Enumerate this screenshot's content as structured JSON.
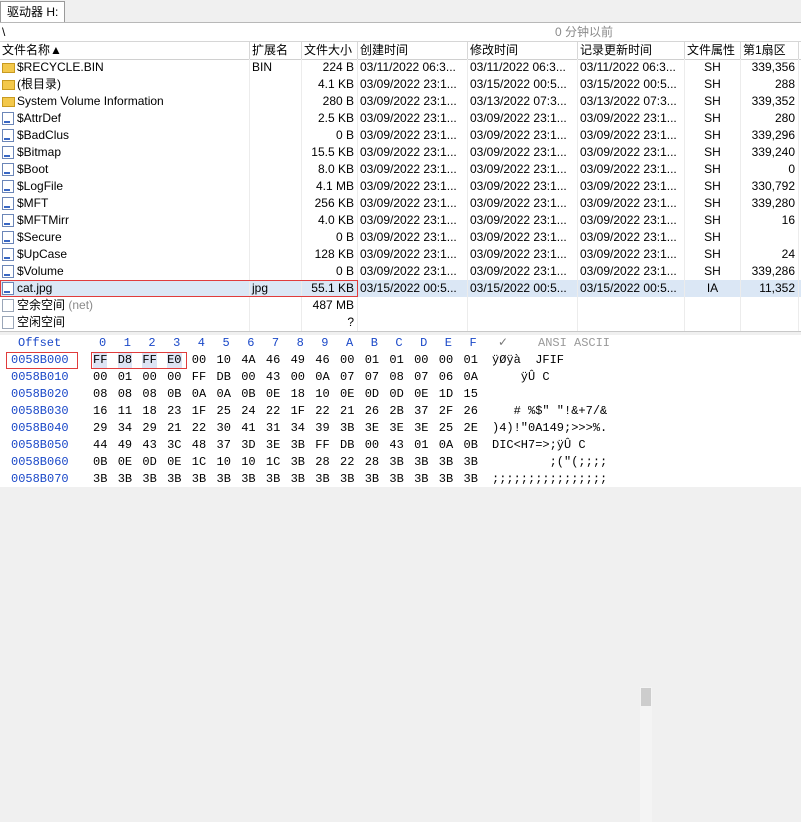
{
  "tab": {
    "label": "驱动器 H:"
  },
  "path": {
    "text": "\\",
    "time_ago": "0 分钟以前"
  },
  "columns": [
    "文件名称▲",
    "扩展名",
    "文件大小",
    "创建时间",
    "修改时间",
    "记录更新时间",
    "文件属性",
    "第1扇区"
  ],
  "rows": [
    {
      "name": "$RECYCLE.BIN",
      "ext": "BIN",
      "size": "224 B",
      "created": "03/11/2022",
      "ctime": "06:3...",
      "modified": "03/11/2022",
      "mtime": "06:3...",
      "updated": "03/11/2022",
      "utime": "06:3...",
      "attr": "SH",
      "sector": "339,356",
      "icon": "folder"
    },
    {
      "name": "(根目录)",
      "ext": "",
      "size": "4.1 KB",
      "created": "03/09/2022",
      "ctime": "23:1...",
      "modified": "03/15/2022",
      "mtime": "00:5...",
      "updated": "03/15/2022",
      "utime": "00:5...",
      "attr": "SH",
      "sector": "288",
      "icon": "folder"
    },
    {
      "name": "System Volume Information",
      "ext": "",
      "size": "280 B",
      "created": "03/09/2022",
      "ctime": "23:1...",
      "modified": "03/13/2022",
      "mtime": "07:3...",
      "updated": "03/13/2022",
      "utime": "07:3...",
      "attr": "SH",
      "sector": "339,352",
      "icon": "folder"
    },
    {
      "name": "$AttrDef",
      "ext": "",
      "size": "2.5 KB",
      "created": "03/09/2022",
      "ctime": "23:1...",
      "modified": "03/09/2022",
      "mtime": "23:1...",
      "updated": "03/09/2022",
      "utime": "23:1...",
      "attr": "SH",
      "sector": "280",
      "icon": "file"
    },
    {
      "name": "$BadClus",
      "ext": "",
      "size": "0 B",
      "created": "03/09/2022",
      "ctime": "23:1...",
      "modified": "03/09/2022",
      "mtime": "23:1...",
      "updated": "03/09/2022",
      "utime": "23:1...",
      "attr": "SH",
      "sector": "339,296",
      "icon": "file"
    },
    {
      "name": "$Bitmap",
      "ext": "",
      "size": "15.5 KB",
      "created": "03/09/2022",
      "ctime": "23:1...",
      "modified": "03/09/2022",
      "mtime": "23:1...",
      "updated": "03/09/2022",
      "utime": "23:1...",
      "attr": "SH",
      "sector": "339,240",
      "icon": "file"
    },
    {
      "name": "$Boot",
      "ext": "",
      "size": "8.0 KB",
      "created": "03/09/2022",
      "ctime": "23:1...",
      "modified": "03/09/2022",
      "mtime": "23:1...",
      "updated": "03/09/2022",
      "utime": "23:1...",
      "attr": "SH",
      "sector": "0",
      "icon": "file"
    },
    {
      "name": "$LogFile",
      "ext": "",
      "size": "4.1 MB",
      "created": "03/09/2022",
      "ctime": "23:1...",
      "modified": "03/09/2022",
      "mtime": "23:1...",
      "updated": "03/09/2022",
      "utime": "23:1...",
      "attr": "SH",
      "sector": "330,792",
      "icon": "file"
    },
    {
      "name": "$MFT",
      "ext": "",
      "size": "256 KB",
      "created": "03/09/2022",
      "ctime": "23:1...",
      "modified": "03/09/2022",
      "mtime": "23:1...",
      "updated": "03/09/2022",
      "utime": "23:1...",
      "attr": "SH",
      "sector": "339,280",
      "icon": "file"
    },
    {
      "name": "$MFTMirr",
      "ext": "",
      "size": "4.0 KB",
      "created": "03/09/2022",
      "ctime": "23:1...",
      "modified": "03/09/2022",
      "mtime": "23:1...",
      "updated": "03/09/2022",
      "utime": "23:1...",
      "attr": "SH",
      "sector": "16",
      "icon": "file"
    },
    {
      "name": "$Secure",
      "ext": "",
      "size": "0 B",
      "created": "03/09/2022",
      "ctime": "23:1...",
      "modified": "03/09/2022",
      "mtime": "23:1...",
      "updated": "03/09/2022",
      "utime": "23:1...",
      "attr": "SH",
      "sector": "",
      "icon": "file"
    },
    {
      "name": "$UpCase",
      "ext": "",
      "size": "128 KB",
      "created": "03/09/2022",
      "ctime": "23:1...",
      "modified": "03/09/2022",
      "mtime": "23:1...",
      "updated": "03/09/2022",
      "utime": "23:1...",
      "attr": "SH",
      "sector": "24",
      "icon": "file"
    },
    {
      "name": "$Volume",
      "ext": "",
      "size": "0 B",
      "created": "03/09/2022",
      "ctime": "23:1...",
      "modified": "03/09/2022",
      "mtime": "23:1...",
      "updated": "03/09/2022",
      "utime": "23:1...",
      "attr": "SH",
      "sector": "339,286",
      "icon": "file"
    },
    {
      "name": "cat.jpg",
      "ext": "jpg",
      "size": "55.1 KB",
      "created": "03/15/2022",
      "ctime": "00:5...",
      "modified": "03/15/2022",
      "mtime": "00:5...",
      "updated": "03/15/2022",
      "utime": "00:5...",
      "attr": "IA",
      "sector": "11,352",
      "icon": "file",
      "selected": true
    },
    {
      "name": "空余空间",
      "name_note": "(net)",
      "ext": "",
      "size": "487 MB",
      "created": "",
      "ctime": "",
      "modified": "",
      "mtime": "",
      "updated": "",
      "utime": "",
      "attr": "",
      "sector": "",
      "icon": "space"
    },
    {
      "name": "空闲空间",
      "ext": "",
      "size": "?",
      "created": "",
      "ctime": "",
      "modified": "",
      "mtime": "",
      "updated": "",
      "utime": "",
      "attr": "",
      "sector": "",
      "icon": "space"
    }
  ],
  "hex": {
    "offset_label": "Offset",
    "col_headers": [
      "0",
      "1",
      "2",
      "3",
      "4",
      "5",
      "6",
      "7",
      "8",
      "9",
      "A",
      "B",
      "C",
      "D",
      "E",
      "F"
    ],
    "ascii_label": "ANSI ASCII",
    "lines": [
      {
        "offset": "0058B000",
        "bytes": [
          "FF",
          "D8",
          "FF",
          "E0",
          "00",
          "10",
          "4A",
          "46",
          "49",
          "46",
          "00",
          "01",
          "01",
          "00",
          "00",
          "01"
        ],
        "ascii": "ÿØÿà  JFIF"
      },
      {
        "offset": "0058B010",
        "bytes": [
          "00",
          "01",
          "00",
          "00",
          "FF",
          "DB",
          "00",
          "43",
          "00",
          "0A",
          "07",
          "07",
          "08",
          "07",
          "06",
          "0A"
        ],
        "ascii": "    ÿÛ C"
      },
      {
        "offset": "0058B020",
        "bytes": [
          "08",
          "08",
          "08",
          "0B",
          "0A",
          "0A",
          "0B",
          "0E",
          "18",
          "10",
          "0E",
          "0D",
          "0D",
          "0E",
          "1D",
          "15"
        ],
        "ascii": ""
      },
      {
        "offset": "0058B030",
        "bytes": [
          "16",
          "11",
          "18",
          "23",
          "1F",
          "25",
          "24",
          "22",
          "1F",
          "22",
          "21",
          "26",
          "2B",
          "37",
          "2F",
          "26"
        ],
        "ascii": "   # %$\" \"!&+7/&"
      },
      {
        "offset": "0058B040",
        "bytes": [
          "29",
          "34",
          "29",
          "21",
          "22",
          "30",
          "41",
          "31",
          "34",
          "39",
          "3B",
          "3E",
          "3E",
          "3E",
          "25",
          "2E"
        ],
        "ascii": ")4)!\"0A149;>>>%."
      },
      {
        "offset": "0058B050",
        "bytes": [
          "44",
          "49",
          "43",
          "3C",
          "48",
          "37",
          "3D",
          "3E",
          "3B",
          "FF",
          "DB",
          "00",
          "43",
          "01",
          "0A",
          "0B"
        ],
        "ascii": "DIC<H7=>;ÿÛ C"
      },
      {
        "offset": "0058B060",
        "bytes": [
          "0B",
          "0E",
          "0D",
          "0E",
          "1C",
          "10",
          "10",
          "1C",
          "3B",
          "28",
          "22",
          "28",
          "3B",
          "3B",
          "3B",
          "3B"
        ],
        "ascii": "        ;(\"(;;;;"
      },
      {
        "offset": "0058B070",
        "bytes": [
          "3B",
          "3B",
          "3B",
          "3B",
          "3B",
          "3B",
          "3B",
          "3B",
          "3B",
          "3B",
          "3B",
          "3B",
          "3B",
          "3B",
          "3B",
          "3B"
        ],
        "ascii": ";;;;;;;;;;;;;;;;"
      }
    ]
  }
}
